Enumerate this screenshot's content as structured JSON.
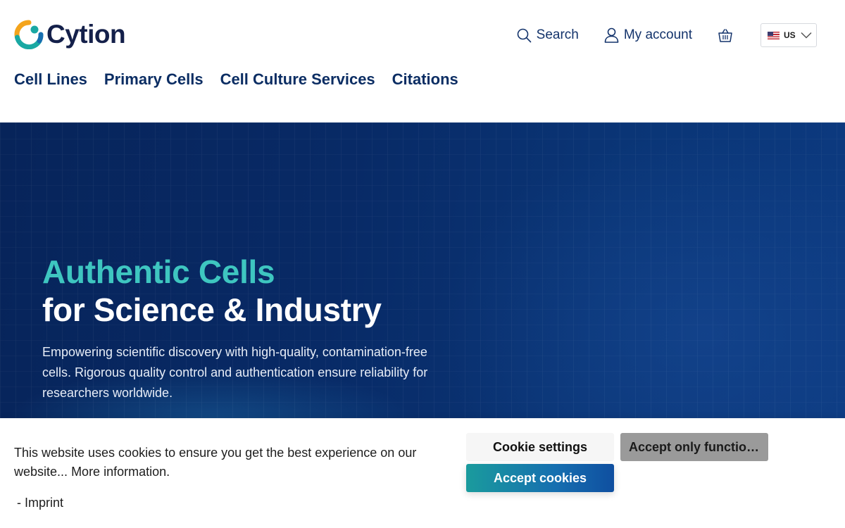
{
  "brand": {
    "name": "Cytion",
    "colors": {
      "navy": "#14204a",
      "teal": "#3ec6c0",
      "orange": "#f4a41c",
      "blue": "#0b2d63"
    }
  },
  "header": {
    "search_label": "Search",
    "account_label": "My account",
    "cart_icon": "basket-icon",
    "language": {
      "code": "US",
      "flag": "us-flag-icon"
    }
  },
  "nav": {
    "items": [
      {
        "label": "Cell Lines"
      },
      {
        "label": "Primary Cells"
      },
      {
        "label": "Cell Culture Services"
      },
      {
        "label": "Citations"
      }
    ]
  },
  "hero": {
    "title_line1": "Authentic Cells",
    "title_line2": "for Science & Industry",
    "description": "Empowering scientific discovery with high-quality, contamination-free cells. Rigorous quality control and authentication ensure reliability for researchers worldwide."
  },
  "cookie_banner": {
    "message": "This website uses cookies to ensure you get the best experience on our website...",
    "more_info_label": "More information.",
    "imprint_label": "- Imprint",
    "settings_button": "Cookie settings",
    "functional_button": "Accept only functional cookies",
    "accept_button": "Accept cookies"
  }
}
